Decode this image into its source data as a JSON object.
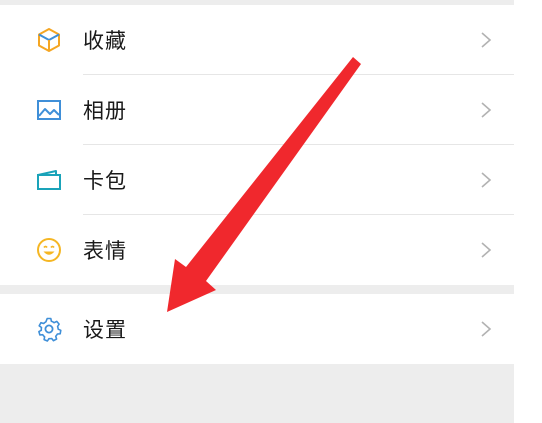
{
  "menu": {
    "items": [
      {
        "label": "收藏",
        "icon": "favorites-cube-icon"
      },
      {
        "label": "相册",
        "icon": "album-picture-icon"
      },
      {
        "label": "卡包",
        "icon": "card-wallet-icon"
      },
      {
        "label": "表情",
        "icon": "smiley-face-icon"
      }
    ],
    "settings": {
      "label": "设置",
      "icon": "gear-icon"
    },
    "chevron_icon": "chevron-right-icon"
  },
  "colors": {
    "background": "#ededed",
    "row": "#ffffff",
    "text": "#1a1a1a",
    "chevron": "#b2b2b2",
    "icon_orange": "#f5a623",
    "icon_blue": "#3f8fd8",
    "icon_teal": "#1aa3b9",
    "icon_yellow": "#f5b623",
    "annotation_arrow": "#f0282d"
  }
}
